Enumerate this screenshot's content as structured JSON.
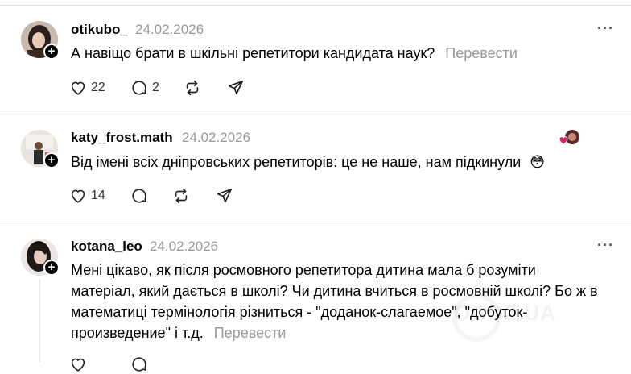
{
  "posts": [
    {
      "username": "otikubo_",
      "date": "24.02.2026",
      "text": "А навіщо брати в шкільні репетитори кандидата наук?",
      "translate": "Перевести",
      "likes": "22",
      "replies": "2",
      "more": "···"
    },
    {
      "username": "katy_frost.math",
      "date": "24.02.2026",
      "text": "Від імені всіх дніпровських репетиторів: це не наше, нам підкинули",
      "emoji": "😳",
      "likes": "14",
      "more": "···"
    },
    {
      "username": "kotana_leo",
      "date": "24.02.2026",
      "text_lines": [
        "Мені цікаво, як після росмовного репетитора дитина мала б розуміти",
        "матеріал, який дається в школі? Чи дитина вчиться в росмовній школі? Бо ж в",
        "математиці термінологія різниться - \"доданок-слагаемое\", \"добуток-",
        "произведение\" і т.д."
      ],
      "translate": "Перевести",
      "more": "···"
    }
  ],
  "watermark": "OBOZ.UA",
  "colors": {
    "text": "#000000",
    "muted": "#999999",
    "divider": "#e2e2e2",
    "like_heart": "#e0245e"
  },
  "icons": [
    "like-icon",
    "reply-icon",
    "repost-icon",
    "share-icon",
    "more-icon",
    "follow-plus-icon"
  ]
}
